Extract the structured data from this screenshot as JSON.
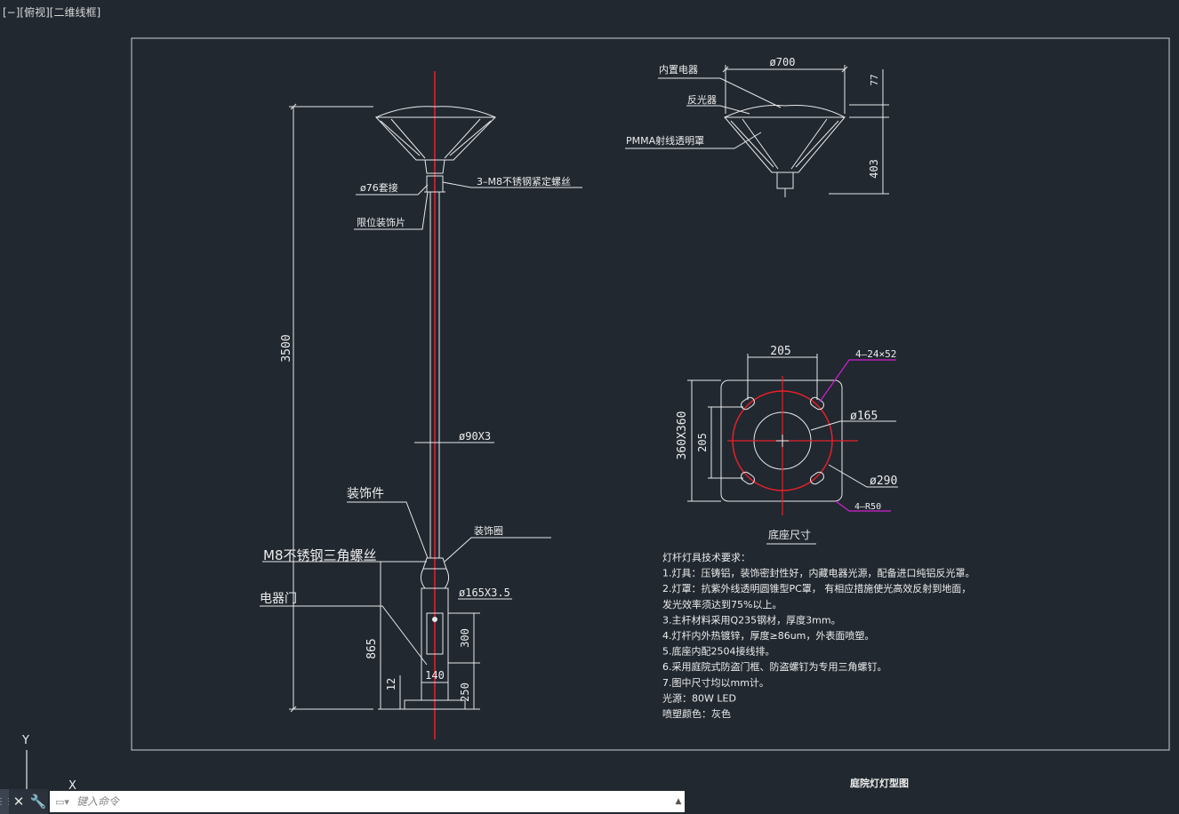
{
  "viewport": {
    "label": "[−][俯视][二维线框]"
  },
  "drawing": {
    "title_block": {
      "drawing_name": "庭院灯灯型图"
    },
    "pole_view": {
      "dim_height": "3500",
      "dim_base_height": "865",
      "dim_flange": "12",
      "dim_door_height": "300",
      "dim_base_section": "250",
      "dim_door_width": "140",
      "label_socket": "ø76套接",
      "label_set_screw": "3–M8不锈钢紧定螺丝",
      "label_limit_piece": "限位装饰片",
      "label_pole_dia": "ø90X3",
      "label_ornament": "装饰件",
      "label_ornament_ring": "装饰圈",
      "label_tri_screw": "M8不锈钢三角螺丝",
      "label_base_dia": "ø165X3.5",
      "label_door": "电器门"
    },
    "lamp_view": {
      "dim_width": "ø700",
      "dim_top": "77",
      "dim_height": "403",
      "label_driver": "内置电器",
      "label_reflector": "反光器",
      "label_cover": "PMMA射线透明罩"
    },
    "base_plate_view": {
      "dim_bolt_spacing_h": "205",
      "dim_bolt_spacing_v": "205",
      "dim_plate": "360X360",
      "label_slots": "4–24×52",
      "label_hole": "ø165",
      "label_bolt_circle": "ø290",
      "label_corner_radius": "4–R50",
      "caption": "底座尺寸"
    },
    "tech_notes": [
      "灯杆灯具技术要求：",
      "1.灯具：压铸铝，装饰密封性好，内藏电器光源，配备进口纯铝反光罩。",
      "2.灯罩：抗紫外线透明圆锥型PC罩， 有相应措施使光高效反射到地面，",
      "发光效率须达到75%以上。",
      "3.主杆材料采用Q235钢材，厚度3mm。",
      "4.灯杆内外热镀锌，厚度≥86um，外表面喷塑。",
      "5.底座内配2504接线排。",
      "6.采用庭院式防盗门框、防盗螺钉为专用三角螺钉。",
      "7.图中尺寸均以mm计。",
      "光源：80W LED",
      "喷塑颜色：灰色"
    ]
  },
  "ucs": {
    "y_label": "Y",
    "x_label": "X"
  },
  "command_line": {
    "close_icon": "close-icon",
    "customize_icon": "wrench-icon",
    "placeholder": "键入命令"
  },
  "colors": {
    "background": "#212830",
    "line": "#e8e8e8",
    "centerline": "#e8202a",
    "leader_magenta": "#d020d0"
  }
}
